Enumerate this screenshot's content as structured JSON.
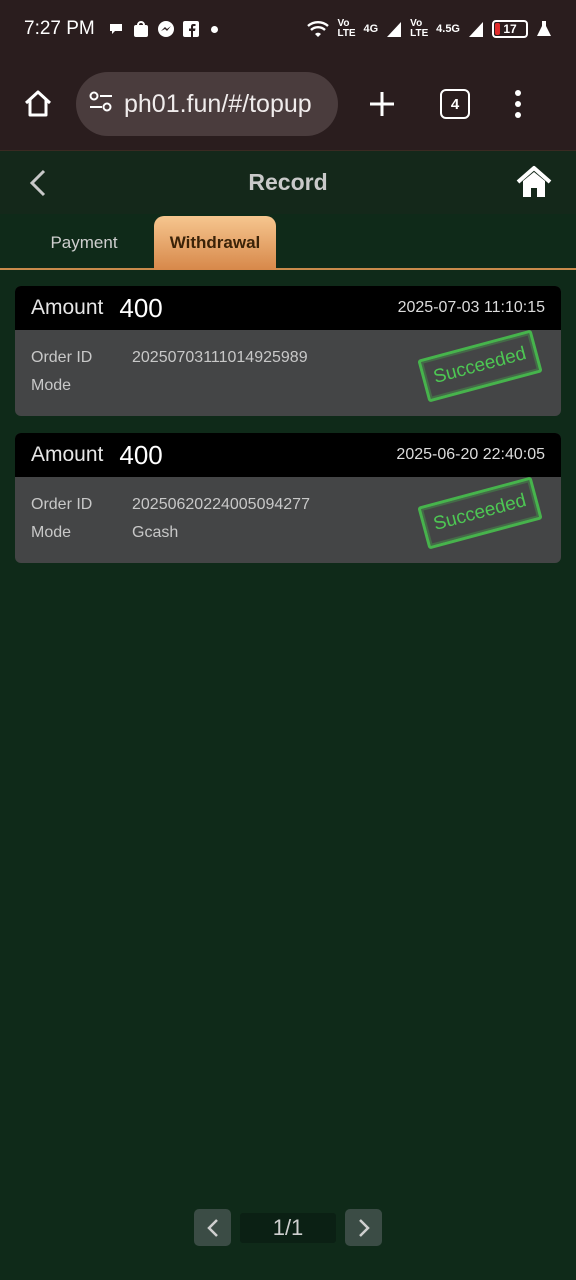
{
  "status_bar": {
    "time": "7:27 PM",
    "net1": "Vo LTE",
    "net2": "4G",
    "net3": "Vo LTE",
    "net4": "4.5G",
    "battery": "17",
    "icons": [
      "chat-icon",
      "shopee-icon",
      "messenger-icon",
      "facebook-icon",
      "wifi-icon",
      "signal-icon",
      "flask-icon"
    ]
  },
  "browser": {
    "url": "ph01.fun/#/topup",
    "tab_count": "4"
  },
  "header": {
    "title": "Record"
  },
  "tabs": [
    {
      "label": "Payment",
      "active": false
    },
    {
      "label": "Withdrawal",
      "active": true
    }
  ],
  "records": [
    {
      "amount_label": "Amount",
      "amount": "400",
      "datetime": "2025-07-03 11:10:15",
      "order_label": "Order ID",
      "order_id": "20250703111014925989",
      "mode_label": "Mode",
      "mode": "",
      "status": "Succeeded"
    },
    {
      "amount_label": "Amount",
      "amount": "400",
      "datetime": "2025-06-20 22:40:05",
      "order_label": "Order ID",
      "order_id": "20250620224005094277",
      "mode_label": "Mode",
      "mode": "Gcash",
      "status": "Succeeded"
    }
  ],
  "pagination": {
    "page": "1/1"
  },
  "colors": {
    "background": "#0f2a19",
    "tab_active": "#d7884a",
    "stamp_green": "#48c04d"
  }
}
